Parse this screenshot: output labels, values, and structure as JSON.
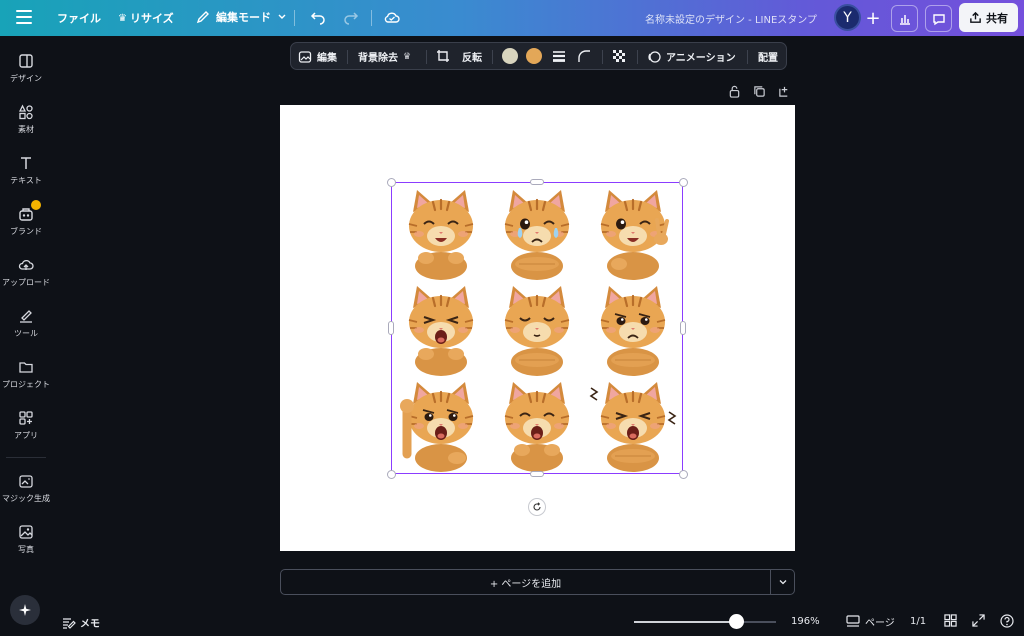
{
  "topbar": {
    "file": "ファイル",
    "resize": "リサイズ",
    "edit_mode": "編集モード",
    "doc_title": "名称未設定のデザイン - LINEスタンプ",
    "avatar_initial": "Y",
    "share": "共有"
  },
  "sidebar": {
    "items": [
      {
        "label": "デザイン",
        "icon": "layout-icon"
      },
      {
        "label": "素材",
        "icon": "elements-icon"
      },
      {
        "label": "テキスト",
        "icon": "text-icon"
      },
      {
        "label": "ブランド",
        "icon": "brand-icon"
      },
      {
        "label": "アップロード",
        "icon": "upload-icon"
      },
      {
        "label": "ツール",
        "icon": "draw-icon"
      },
      {
        "label": "プロジェクト",
        "icon": "folder-icon"
      },
      {
        "label": "アプリ",
        "icon": "apps-icon"
      },
      {
        "label": "マジック生成",
        "icon": "magic-media-icon"
      },
      {
        "label": "写真",
        "icon": "photo-icon"
      }
    ]
  },
  "context_toolbar": {
    "edit": "編集",
    "bg_remove": "背景除去",
    "flip": "反転",
    "animation": "アニメーション",
    "position": "配置",
    "swatch_colors": [
      "#d8d4be",
      "#e3a758"
    ]
  },
  "stickers": [
    {
      "expression": "happy-closed-eyes"
    },
    {
      "expression": "crying"
    },
    {
      "expression": "wink-peace"
    },
    {
      "expression": "yawning"
    },
    {
      "expression": "sleepy"
    },
    {
      "expression": "annoyed-arms-crossed"
    },
    {
      "expression": "angry-fist"
    },
    {
      "expression": "laughing"
    },
    {
      "expression": "frustrated"
    }
  ],
  "canvas": {
    "add_page": "+ ページを追加"
  },
  "bottombar": {
    "memo": "メモ",
    "zoom": "196%",
    "zoom_fraction": 0.72,
    "pages": "ページ",
    "page_count": "1/1"
  }
}
